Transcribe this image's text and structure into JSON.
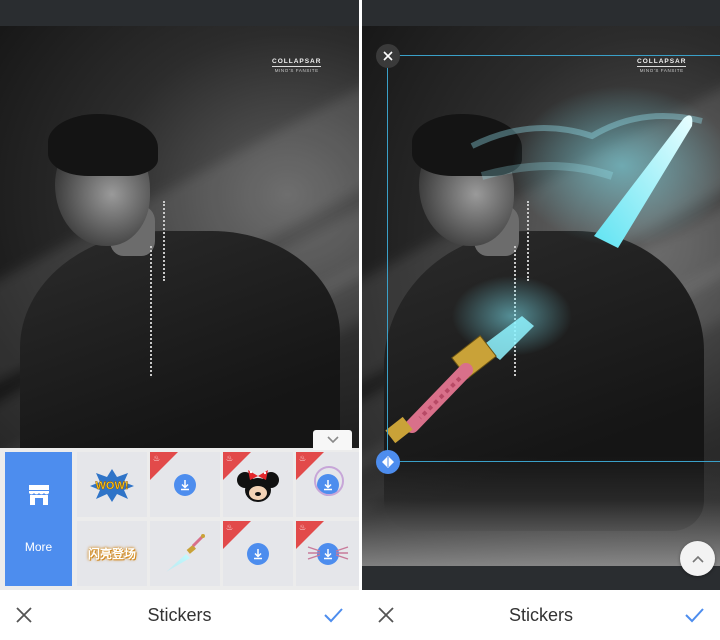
{
  "left": {
    "watermark": {
      "title": "COLLAPSAR",
      "subtitle": "MINO'S FANSITE"
    },
    "tray": {
      "more_label": "More",
      "tiles": [
        {
          "kind": "wow-sticker",
          "text": "WOW!"
        },
        {
          "kind": "download",
          "new": true
        },
        {
          "kind": "minnie-sticker",
          "new": true
        },
        {
          "kind": "download",
          "new": true
        },
        {
          "kind": "text-sticker",
          "text": "闪亮登场"
        },
        {
          "kind": "sword-sticker"
        },
        {
          "kind": "download",
          "new": true
        },
        {
          "kind": "download",
          "new": true
        }
      ]
    },
    "bottom_bar": {
      "title": "Stickers"
    }
  },
  "right": {
    "watermark": {
      "title": "COLLAPSAR",
      "subtitle": "MINO'S FANSITE"
    },
    "bottom_bar": {
      "title": "Stickers"
    }
  },
  "colors": {
    "accent": "#4d8dee",
    "new_ribbon": "#e24a4a",
    "selection": "#3aa0c8",
    "status_bar": "#2a2d30"
  },
  "icons": [
    "store-icon",
    "download-icon",
    "chevron-down-icon",
    "close-icon",
    "check-icon",
    "flip-icon",
    "chevron-up-icon"
  ]
}
